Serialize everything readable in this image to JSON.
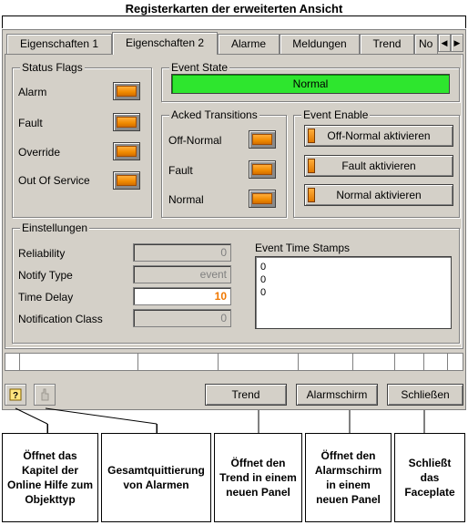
{
  "header": {
    "title": "Registerkarten der erweiterten Ansicht"
  },
  "tabs": [
    {
      "label": "Eigenschaften 1",
      "active": false
    },
    {
      "label": "Eigenschaften 2",
      "active": true
    },
    {
      "label": "Alarme",
      "active": false
    },
    {
      "label": "Meldungen",
      "active": false
    },
    {
      "label": "Trend",
      "active": false
    },
    {
      "label": "No",
      "active": false
    }
  ],
  "tab_nav": {
    "left_icon": "arrow-left-icon",
    "right_icon": "arrow-right-icon"
  },
  "status_flags": {
    "title": "Status Flags",
    "items": [
      "Alarm",
      "Fault",
      "Override",
      "Out Of Service"
    ],
    "led_color": "#f08a00"
  },
  "event_state": {
    "title": "Event State",
    "value": "Normal",
    "color": "#2ee62e"
  },
  "acked_transitions": {
    "title": "Acked Transitions",
    "items": [
      "Off-Normal",
      "Fault",
      "Normal"
    ]
  },
  "event_enable": {
    "title": "Event Enable",
    "buttons": [
      "Off-Normal aktivieren",
      "Fault aktivieren",
      "Normal aktivieren"
    ]
  },
  "settings": {
    "title": "Einstellungen",
    "rows": [
      {
        "label": "Reliability",
        "value": "0"
      },
      {
        "label": "Notify Type",
        "value": "event"
      },
      {
        "label": "Time Delay",
        "value": "10"
      },
      {
        "label": "Notification Class",
        "value": "0"
      }
    ]
  },
  "timestamps": {
    "title": "Event Time Stamps",
    "values": [
      "0",
      "0",
      "0"
    ]
  },
  "toolbar": {
    "help_icon": "help-icon",
    "ack_icon": "acknowledge-icon",
    "trend_label": "Trend",
    "alarm_label": "Alarmschirm",
    "close_label": "Schließen"
  },
  "callouts": [
    "Öffnet das Kapitel der Online Hilfe zum Objekttyp",
    "Gesamtquittierung von Alarmen",
    "Öffnet den Trend in einem neuen Panel",
    "Öffnet den Alarmschirm in einem neuen Panel",
    "Schließt das Faceplate"
  ]
}
